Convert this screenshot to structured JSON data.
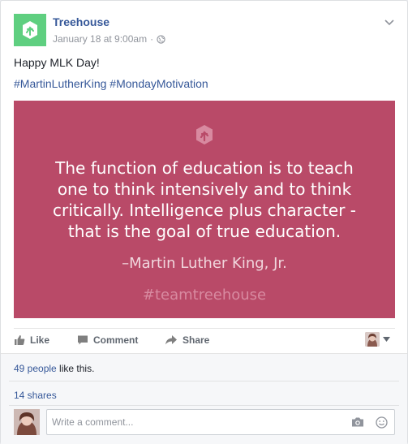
{
  "post": {
    "page_name": "Treehouse",
    "timestamp": "January 18 at 9:00am",
    "separator": "·",
    "status_text": "Happy MLK Day!",
    "hashtags": [
      "#MartinLutherKing",
      "#MondayMotivation"
    ],
    "brand_color": "#5fcf80",
    "privacy_icon": "globe-icon"
  },
  "image": {
    "background_color": "#b94a68",
    "quote_lines": [
      "The function of education is to teach",
      "one to think intensively and to think",
      "critically. Intelligence plus character -",
      "that is the goal of true education."
    ],
    "author": "–Martin Luther King, Jr.",
    "tag": "#teamtreehouse"
  },
  "actions": {
    "like_label": "Like",
    "comment_label": "Comment",
    "share_label": "Share"
  },
  "footer": {
    "likes_link": "49 people",
    "likes_suffix": " like this.",
    "shares_text": "14 shares",
    "comment_placeholder": "Write a comment..."
  }
}
